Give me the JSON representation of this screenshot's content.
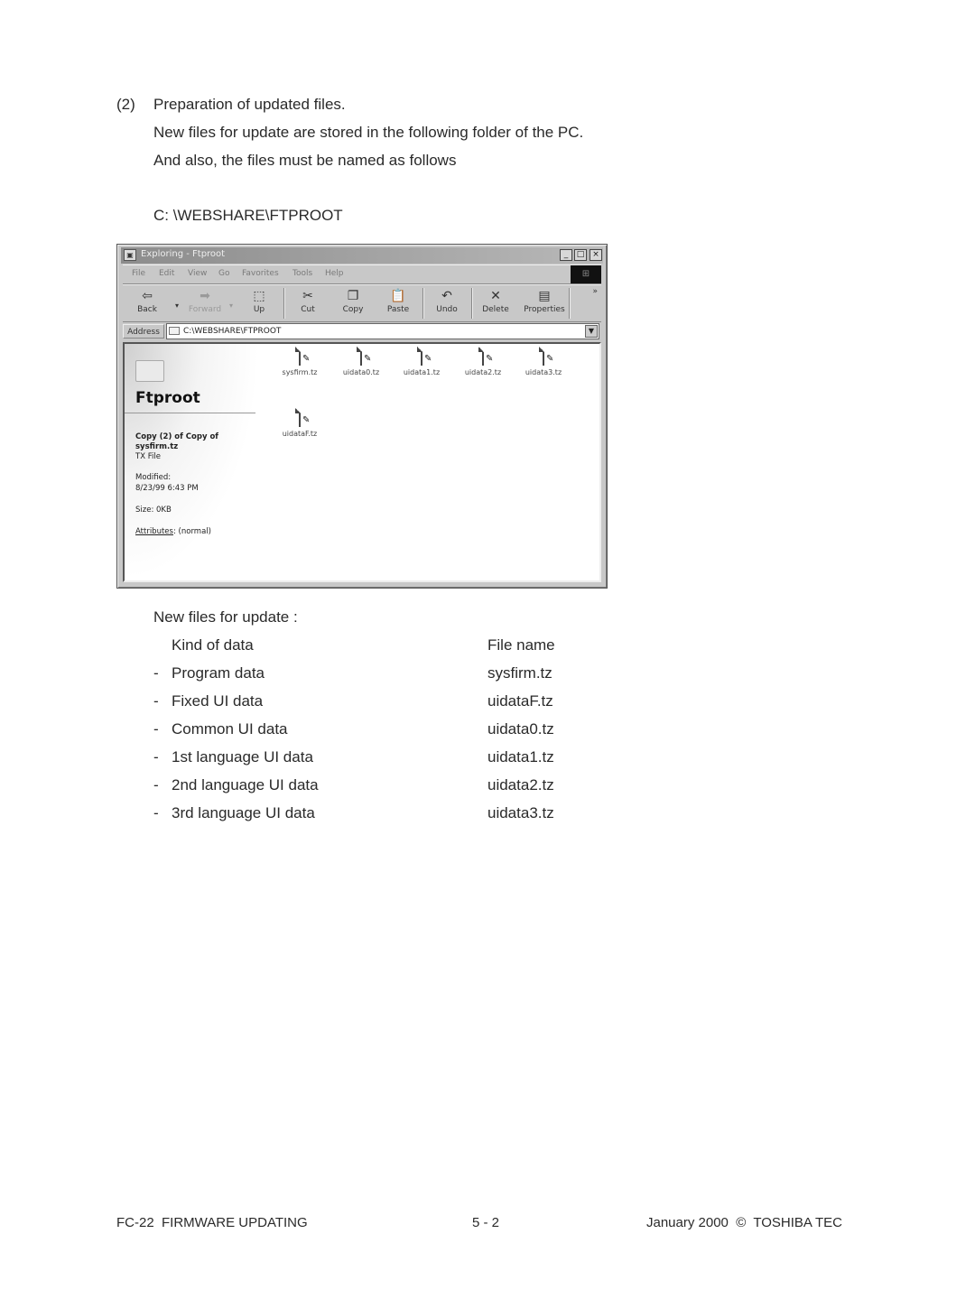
{
  "section": {
    "number": "(2)",
    "heading": "Preparation of updated files.",
    "line1": "New files for update are stored in the following folder of the PC.",
    "line2": "And also, the files must be named as follows",
    "folder_path": "C: \\WEBSHARE\\FTPROOT"
  },
  "explorer": {
    "title": "Exploring - Ftproot",
    "window_buttons": [
      "_",
      "□",
      "×"
    ],
    "menu": [
      "File",
      "Edit",
      "View",
      "Go",
      "Favorites",
      "Tools",
      "Help"
    ],
    "toolbar": [
      {
        "label": "Back",
        "icon": "back-arrow-icon",
        "glyph": "⇦"
      },
      {
        "label": "Forward",
        "icon": "forward-arrow-icon",
        "glyph": "➡"
      },
      {
        "label": "Up",
        "icon": "up-folder-icon",
        "glyph": "⬚"
      },
      {
        "label": "Cut",
        "icon": "scissors-icon",
        "glyph": "✂"
      },
      {
        "label": "Copy",
        "icon": "copy-icon",
        "glyph": "❐"
      },
      {
        "label": "Paste",
        "icon": "paste-icon",
        "glyph": "📋"
      },
      {
        "label": "Undo",
        "icon": "undo-icon",
        "glyph": "↶"
      },
      {
        "label": "Delete",
        "icon": "delete-x-icon",
        "glyph": "✕"
      },
      {
        "label": "Properties",
        "icon": "properties-icon",
        "glyph": "▤"
      }
    ],
    "more_chevron": "»",
    "address_label": "Address",
    "address_value": "C:\\WEBSHARE\\FTPROOT",
    "folder_title": "Ftproot",
    "selected_info": {
      "name_line1": "Copy (2) of Copy of",
      "name_line2": "sysfirm.tz",
      "type": "TX File",
      "modified_label": "Modified:",
      "modified_value": "8/23/99 6:43 PM",
      "size": "Size: 0KB",
      "attributes_label": "Attributes",
      "attributes_value": ": (normal)"
    },
    "files": [
      "sysfirm.tz",
      "uidata0.tz",
      "uidata1.tz",
      "uidata2.tz",
      "uidata3.tz",
      "uidataF.tz"
    ]
  },
  "files_table": {
    "intro": "New files for update :",
    "header_kind": "Kind of data",
    "header_file": "File name",
    "rows": [
      {
        "dash": "-",
        "kind": "Program data",
        "file": "sysfirm.tz"
      },
      {
        "dash": "-",
        "kind": "Fixed UI data",
        "file": "uidataF.tz"
      },
      {
        "dash": "-",
        "kind": "Common UI data",
        "file": "uidata0.tz"
      },
      {
        "dash": "-",
        "kind": "1st language UI data",
        "file": "uidata1.tz"
      },
      {
        "dash": "-",
        "kind": "2nd language UI data",
        "file": "uidata2.tz"
      },
      {
        "dash": "-",
        "kind": "3rd language UI data",
        "file": "uidata3.tz"
      }
    ]
  },
  "footer": {
    "left": "FC-22  FIRMWARE UPDATING",
    "center": "5 - 2",
    "right": "January 2000  ©  TOSHIBA TEC"
  }
}
